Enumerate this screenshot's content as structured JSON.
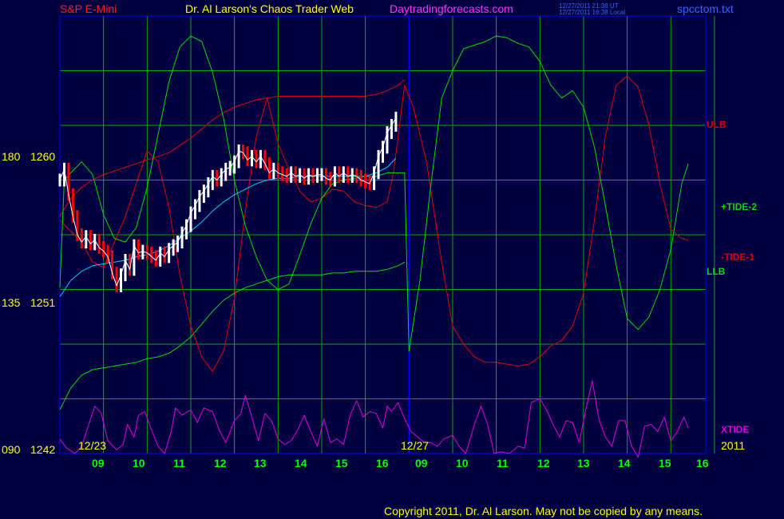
{
  "header": {
    "symbol": "S&P E-Mini",
    "title": "Dr. Al Larson's Chaos Trader Web",
    "site": "Daytradingforecasts.com",
    "utc_stamp": "12/27/2011 21:38 UT",
    "local_stamp": "12/27/2011 16:38 Local",
    "file": "spcctom.txt"
  },
  "footer": {
    "copyright": "Copyright 2011, Dr. Al Larson. May not be copied by any means."
  },
  "colors": {
    "background": "#000040",
    "plot_border": "#0000ff",
    "grid": "#00aa00",
    "price_up": "#ffffff",
    "price_down": "#ff0000",
    "ma": "#00ccff",
    "tide_green": "#00dd00",
    "tide_red": "#dd0000",
    "xtide": "#dd00dd",
    "title_red": "#ff2020",
    "title_yellow": "#ffff00",
    "site_magenta": "#ff33ff",
    "label_blue": "#3366ff",
    "tick_green": "#00ff00"
  },
  "chart_data": {
    "type": "line",
    "title": "S&P E-Mini",
    "y_axis_labels": [
      {
        "angle": "180",
        "price": "1260",
        "value": 1260
      },
      {
        "angle": "135",
        "price": "1251",
        "value": 1251
      },
      {
        "angle": "090",
        "price": "1242",
        "value": 1242
      }
    ],
    "ylim": [
      1242,
      1266
    ],
    "x_hours_day1": [
      "09",
      "10",
      "11",
      "12",
      "13",
      "14",
      "15",
      "16"
    ],
    "x_hours_day2": [
      "09",
      "10",
      "11",
      "12",
      "13",
      "14",
      "15",
      "16"
    ],
    "dates": [
      "12/23",
      "12/27",
      "2011"
    ],
    "series_labels": [
      "ULB",
      "+TIDE-2",
      "-TIDE-1",
      "LLB",
      "XTIDE"
    ],
    "price": [
      [
        0.0,
        1257.0
      ],
      [
        0.2,
        1257.6
      ],
      [
        0.4,
        1256.2
      ],
      [
        0.6,
        1255.0
      ],
      [
        0.8,
        1254.0
      ],
      [
        1.0,
        1253.6
      ],
      [
        1.2,
        1253.9
      ],
      [
        1.4,
        1253.5
      ],
      [
        1.6,
        1253.7
      ],
      [
        1.8,
        1253.3
      ],
      [
        2.0,
        1253.1
      ],
      [
        2.2,
        1252.8
      ],
      [
        2.4,
        1251.9
      ],
      [
        2.6,
        1251.2
      ],
      [
        2.8,
        1251.8
      ],
      [
        3.0,
        1252.6
      ],
      [
        3.2,
        1252.1
      ],
      [
        3.4,
        1253.4
      ],
      [
        3.6,
        1253.0
      ],
      [
        3.8,
        1253.1
      ],
      [
        4.0,
        1253.0
      ],
      [
        4.2,
        1252.8
      ],
      [
        4.4,
        1252.6
      ],
      [
        4.6,
        1253.0
      ],
      [
        4.8,
        1252.8
      ],
      [
        5.0,
        1253.2
      ],
      [
        5.2,
        1253.4
      ],
      [
        5.4,
        1253.6
      ],
      [
        5.6,
        1254.1
      ],
      [
        5.8,
        1254.5
      ],
      [
        6.0,
        1255.2
      ],
      [
        6.2,
        1255.6
      ],
      [
        6.4,
        1256.1
      ],
      [
        6.6,
        1256.4
      ],
      [
        6.8,
        1256.8
      ],
      [
        7.0,
        1257.2
      ],
      [
        7.2,
        1257.0
      ],
      [
        7.4,
        1257.3
      ],
      [
        7.6,
        1257.6
      ],
      [
        7.8,
        1257.7
      ],
      [
        8.0,
        1258.0
      ],
      [
        8.2,
        1258.6
      ],
      [
        8.4,
        1258.5
      ],
      [
        8.6,
        1258.1
      ],
      [
        8.8,
        1258.3
      ],
      [
        9.0,
        1258.0
      ],
      [
        9.2,
        1258.3
      ],
      [
        9.4,
        1257.9
      ],
      [
        9.6,
        1257.4
      ],
      [
        9.8,
        1257.6
      ],
      [
        10.0,
        1257.4
      ],
      [
        10.2,
        1257.3
      ],
      [
        10.4,
        1257.2
      ],
      [
        10.6,
        1257.4
      ],
      [
        10.8,
        1257.2
      ],
      [
        11.0,
        1257.3
      ],
      [
        11.2,
        1257.1
      ],
      [
        11.4,
        1257.3
      ],
      [
        11.6,
        1257.2
      ],
      [
        11.8,
        1257.3
      ],
      [
        12.0,
        1257.3
      ],
      [
        12.2,
        1257.1
      ],
      [
        12.4,
        1257.0
      ],
      [
        12.6,
        1257.4
      ],
      [
        12.8,
        1257.2
      ],
      [
        13.0,
        1257.4
      ],
      [
        13.2,
        1257.2
      ],
      [
        13.4,
        1257.3
      ],
      [
        13.6,
        1257.2
      ],
      [
        13.8,
        1257.0
      ],
      [
        14.0,
        1256.9
      ],
      [
        14.2,
        1256.8
      ],
      [
        14.4,
        1257.4
      ],
      [
        14.6,
        1258.3
      ],
      [
        14.8,
        1258.8
      ],
      [
        15.0,
        1259.6
      ],
      [
        15.2,
        1260.0
      ],
      [
        15.4,
        1260.4
      ]
    ],
    "ma": [
      [
        0.0,
        1250.6
      ],
      [
        0.5,
        1251.5
      ],
      [
        1.0,
        1252.0
      ],
      [
        1.5,
        1252.3
      ],
      [
        2.0,
        1252.4
      ],
      [
        2.5,
        1252.5
      ],
      [
        3.0,
        1252.6
      ],
      [
        3.5,
        1252.8
      ],
      [
        4.0,
        1252.9
      ],
      [
        4.5,
        1253.1
      ],
      [
        5.0,
        1253.4
      ],
      [
        5.5,
        1253.8
      ],
      [
        6.0,
        1254.2
      ],
      [
        6.5,
        1254.7
      ],
      [
        7.0,
        1255.3
      ],
      [
        7.5,
        1255.8
      ],
      [
        8.0,
        1256.2
      ],
      [
        8.5,
        1256.5
      ],
      [
        9.0,
        1256.8
      ],
      [
        9.5,
        1257.0
      ],
      [
        10.0,
        1257.1
      ],
      [
        10.5,
        1257.1
      ],
      [
        11.0,
        1257.2
      ],
      [
        11.5,
        1257.2
      ],
      [
        12.0,
        1257.2
      ],
      [
        12.5,
        1257.2
      ],
      [
        13.0,
        1257.2
      ],
      [
        13.5,
        1257.2
      ],
      [
        14.0,
        1257.2
      ],
      [
        14.5,
        1257.4
      ],
      [
        15.0,
        1257.7
      ],
      [
        15.4,
        1258.2
      ]
    ],
    "ulb": [
      [
        0.0,
        1255.0
      ],
      [
        0.5,
        1256.0
      ],
      [
        1.0,
        1256.6
      ],
      [
        1.5,
        1257.0
      ],
      [
        2.0,
        1257.3
      ],
      [
        2.5,
        1257.5
      ],
      [
        3.0,
        1257.7
      ],
      [
        3.5,
        1257.9
      ],
      [
        4.0,
        1258.1
      ],
      [
        4.5,
        1258.3
      ],
      [
        5.0,
        1258.5
      ],
      [
        5.5,
        1258.9
      ],
      [
        6.0,
        1259.3
      ],
      [
        6.5,
        1259.8
      ],
      [
        7.0,
        1260.3
      ],
      [
        7.5,
        1260.7
      ],
      [
        8.0,
        1261.0
      ],
      [
        8.5,
        1261.2
      ],
      [
        9.0,
        1261.4
      ],
      [
        9.5,
        1261.5
      ],
      [
        10.0,
        1261.6
      ],
      [
        10.5,
        1261.6
      ],
      [
        11.0,
        1261.6
      ],
      [
        11.5,
        1261.6
      ],
      [
        12.0,
        1261.6
      ],
      [
        12.5,
        1261.6
      ],
      [
        13.0,
        1261.6
      ],
      [
        13.5,
        1261.6
      ],
      [
        14.0,
        1261.6
      ],
      [
        14.5,
        1261.7
      ],
      [
        15.0,
        1261.9
      ],
      [
        15.5,
        1262.2
      ],
      [
        15.8,
        1262.5
      ]
    ],
    "llb": [
      [
        0.0,
        1244.4
      ],
      [
        0.5,
        1245.6
      ],
      [
        1.0,
        1246.3
      ],
      [
        1.5,
        1246.6
      ],
      [
        2.0,
        1246.7
      ],
      [
        2.5,
        1246.8
      ],
      [
        3.0,
        1246.9
      ],
      [
        3.5,
        1247.0
      ],
      [
        4.0,
        1247.2
      ],
      [
        4.5,
        1247.3
      ],
      [
        5.0,
        1247.5
      ],
      [
        5.5,
        1247.9
      ],
      [
        6.0,
        1248.4
      ],
      [
        6.5,
        1249.1
      ],
      [
        7.0,
        1249.8
      ],
      [
        7.5,
        1250.4
      ],
      [
        8.0,
        1250.8
      ],
      [
        8.5,
        1251.1
      ],
      [
        9.0,
        1251.3
      ],
      [
        9.5,
        1251.5
      ],
      [
        10.0,
        1251.7
      ],
      [
        10.5,
        1251.8
      ],
      [
        11.0,
        1251.8
      ],
      [
        11.5,
        1251.8
      ],
      [
        12.0,
        1251.8
      ],
      [
        12.5,
        1251.9
      ],
      [
        13.0,
        1251.9
      ],
      [
        13.5,
        1252.0
      ],
      [
        14.0,
        1252.0
      ],
      [
        14.5,
        1252.0
      ],
      [
        15.0,
        1252.1
      ],
      [
        15.5,
        1252.3
      ],
      [
        15.8,
        1252.5
      ]
    ],
    "tide_green": [
      [
        0.0,
        1251.1
      ],
      [
        0.2,
        1257.0
      ],
      [
        0.5,
        1257.4
      ],
      [
        1.0,
        1258.0
      ],
      [
        1.5,
        1257.3
      ],
      [
        2.0,
        1255.1
      ],
      [
        2.5,
        1253.8
      ],
      [
        3.0,
        1253.6
      ],
      [
        3.5,
        1254.4
      ],
      [
        4.0,
        1256.6
      ],
      [
        4.5,
        1259.5
      ],
      [
        5.0,
        1262.4
      ],
      [
        5.5,
        1264.3
      ],
      [
        6.0,
        1264.9
      ],
      [
        6.5,
        1264.6
      ],
      [
        7.0,
        1262.9
      ],
      [
        7.5,
        1260.4
      ],
      [
        8.0,
        1257.0
      ],
      [
        8.5,
        1254.5
      ],
      [
        9.0,
        1252.8
      ],
      [
        9.5,
        1251.5
      ],
      [
        10.0,
        1251.0
      ],
      [
        10.5,
        1251.3
      ],
      [
        11.0,
        1252.9
      ],
      [
        11.5,
        1254.6
      ],
      [
        12.0,
        1256.0
      ],
      [
        12.5,
        1256.8
      ],
      [
        13.0,
        1257.0
      ],
      [
        13.5,
        1257.1
      ],
      [
        14.0,
        1257.2
      ],
      [
        14.5,
        1257.2
      ],
      [
        15.0,
        1257.4
      ],
      [
        15.8,
        1257.4
      ],
      [
        16.0,
        1247.6
      ],
      [
        16.5,
        1251.5
      ],
      [
        17.0,
        1256.7
      ],
      [
        17.5,
        1261.5
      ],
      [
        18.0,
        1263.0
      ],
      [
        18.5,
        1264.2
      ],
      [
        19.0,
        1264.4
      ],
      [
        19.5,
        1264.6
      ],
      [
        20.0,
        1264.9
      ],
      [
        20.5,
        1264.8
      ],
      [
        21.0,
        1264.5
      ],
      [
        21.5,
        1264.3
      ],
      [
        22.0,
        1263.5
      ],
      [
        22.5,
        1262.2
      ],
      [
        23.0,
        1261.5
      ],
      [
        23.5,
        1261.9
      ],
      [
        24.0,
        1261.0
      ],
      [
        24.5,
        1258.8
      ],
      [
        25.0,
        1255.6
      ],
      [
        25.5,
        1252.3
      ],
      [
        26.0,
        1249.4
      ],
      [
        26.5,
        1248.8
      ],
      [
        27.0,
        1249.5
      ],
      [
        27.5,
        1251.0
      ],
      [
        28.0,
        1253.2
      ],
      [
        28.5,
        1256.8
      ],
      [
        28.8,
        1257.9
      ]
    ],
    "tide_red": [
      [
        0.0,
        1254.8
      ],
      [
        0.5,
        1254.2
      ],
      [
        1.0,
        1253.6
      ],
      [
        1.5,
        1252.5
      ],
      [
        2.0,
        1252.2
      ],
      [
        2.5,
        1253.6
      ],
      [
        3.0,
        1255.0
      ],
      [
        3.5,
        1256.8
      ],
      [
        4.0,
        1258.6
      ],
      [
        4.5,
        1258.0
      ],
      [
        5.0,
        1255.5
      ],
      [
        5.5,
        1251.8
      ],
      [
        6.0,
        1249.0
      ],
      [
        6.5,
        1247.3
      ],
      [
        7.0,
        1246.5
      ],
      [
        7.5,
        1247.6
      ],
      [
        8.0,
        1250.5
      ],
      [
        8.5,
        1255.3
      ],
      [
        9.0,
        1259.4
      ],
      [
        9.5,
        1261.5
      ],
      [
        10.0,
        1259.0
      ],
      [
        10.5,
        1257.6
      ],
      [
        11.0,
        1256.4
      ],
      [
        11.5,
        1255.8
      ],
      [
        12.0,
        1256.0
      ],
      [
        12.5,
        1256.5
      ],
      [
        13.0,
        1256.4
      ],
      [
        13.5,
        1255.8
      ],
      [
        14.0,
        1255.6
      ],
      [
        14.5,
        1255.5
      ],
      [
        15.0,
        1255.8
      ],
      [
        15.3,
        1257.5
      ],
      [
        15.8,
        1262.2
      ],
      [
        16.2,
        1261.0
      ],
      [
        16.8,
        1258.0
      ],
      [
        17.5,
        1252.5
      ],
      [
        18.0,
        1249.0
      ],
      [
        18.5,
        1248.0
      ],
      [
        19.0,
        1247.3
      ],
      [
        19.5,
        1247.0
      ],
      [
        20.0,
        1247.0
      ],
      [
        20.5,
        1246.9
      ],
      [
        21.0,
        1246.8
      ],
      [
        21.5,
        1246.9
      ],
      [
        22.0,
        1247.3
      ],
      [
        22.5,
        1247.9
      ],
      [
        23.0,
        1248.2
      ],
      [
        23.5,
        1249.0
      ],
      [
        24.0,
        1250.8
      ],
      [
        24.5,
        1254.8
      ],
      [
        25.0,
        1259.4
      ],
      [
        25.5,
        1262.2
      ],
      [
        26.0,
        1262.7
      ],
      [
        26.5,
        1262.1
      ],
      [
        27.0,
        1260.0
      ],
      [
        27.5,
        1256.8
      ],
      [
        28.0,
        1254.3
      ],
      [
        28.5,
        1253.8
      ],
      [
        28.8,
        1253.7
      ]
    ],
    "xtide": [
      [
        0.0,
        1242.8
      ],
      [
        0.3,
        1242.3
      ],
      [
        0.7,
        1242.0
      ],
      [
        1.0,
        1242.4
      ],
      [
        1.3,
        1243.5
      ],
      [
        1.6,
        1244.6
      ],
      [
        1.9,
        1244.2
      ],
      [
        2.2,
        1242.7
      ],
      [
        2.6,
        1242.2
      ],
      [
        2.9,
        1242.5
      ],
      [
        3.1,
        1243.6
      ],
      [
        3.4,
        1242.9
      ],
      [
        3.6,
        1244.1
      ],
      [
        3.9,
        1244.3
      ],
      [
        4.1,
        1243.6
      ],
      [
        4.5,
        1242.4
      ],
      [
        4.8,
        1242.0
      ],
      [
        5.1,
        1243.2
      ],
      [
        5.3,
        1244.5
      ],
      [
        5.6,
        1244.1
      ],
      [
        6.0,
        1244.4
      ],
      [
        6.3,
        1243.7
      ],
      [
        6.6,
        1244.5
      ],
      [
        7.0,
        1244.3
      ],
      [
        7.3,
        1243.3
      ],
      [
        7.6,
        1242.6
      ],
      [
        8.0,
        1243.8
      ],
      [
        8.3,
        1244.2
      ],
      [
        8.5,
        1245.2
      ],
      [
        8.8,
        1244.0
      ],
      [
        9.1,
        1242.7
      ],
      [
        9.4,
        1244.2
      ],
      [
        9.7,
        1243.8
      ],
      [
        10.0,
        1242.8
      ],
      [
        10.3,
        1242.5
      ],
      [
        10.6,
        1242.7
      ],
      [
        10.9,
        1243.3
      ],
      [
        11.2,
        1244.1
      ],
      [
        11.5,
        1243.2
      ],
      [
        11.8,
        1242.4
      ],
      [
        12.1,
        1243.9
      ],
      [
        12.4,
        1242.6
      ],
      [
        12.7,
        1242.8
      ],
      [
        13.0,
        1242.5
      ],
      [
        13.3,
        1244.1
      ],
      [
        13.6,
        1244.9
      ],
      [
        13.9,
        1244.0
      ],
      [
        14.2,
        1244.3
      ],
      [
        14.5,
        1244.2
      ],
      [
        14.8,
        1243.4
      ],
      [
        15.0,
        1244.6
      ],
      [
        15.2,
        1244.3
      ],
      [
        15.5,
        1244.8
      ],
      [
        15.8,
        1243.9
      ],
      [
        16.1,
        1243.2
      ],
      [
        16.4,
        1242.9
      ],
      [
        16.7,
        1242.6
      ],
      [
        17.0,
        1242.6
      ],
      [
        17.3,
        1242.4
      ],
      [
        17.6,
        1242.8
      ],
      [
        18.0,
        1243.0
      ],
      [
        18.3,
        1242.4
      ],
      [
        18.6,
        1242.0
      ],
      [
        19.0,
        1243.6
      ],
      [
        19.3,
        1244.6
      ],
      [
        19.6,
        1243.6
      ],
      [
        19.9,
        1242.0
      ],
      [
        20.2,
        1242.1
      ],
      [
        20.6,
        1242.0
      ],
      [
        21.0,
        1242.4
      ],
      [
        21.3,
        1242.3
      ],
      [
        21.6,
        1244.8
      ],
      [
        22.0,
        1245.0
      ],
      [
        22.3,
        1244.4
      ],
      [
        22.6,
        1243.6
      ],
      [
        22.9,
        1242.9
      ],
      [
        23.2,
        1243.8
      ],
      [
        23.5,
        1243.7
      ],
      [
        23.8,
        1242.6
      ],
      [
        24.1,
        1244.4
      ],
      [
        24.4,
        1246.0
      ],
      [
        24.7,
        1243.9
      ],
      [
        25.0,
        1242.9
      ],
      [
        25.3,
        1242.4
      ],
      [
        25.6,
        1243.8
      ],
      [
        25.9,
        1243.8
      ],
      [
        26.2,
        1242.4
      ],
      [
        26.5,
        1241.8
      ],
      [
        26.8,
        1243.5
      ],
      [
        27.1,
        1243.6
      ],
      [
        27.4,
        1243.2
      ],
      [
        27.7,
        1244.0
      ],
      [
        28.0,
        1242.7
      ],
      [
        28.3,
        1243.2
      ],
      [
        28.6,
        1244.0
      ],
      [
        28.8,
        1243.4
      ]
    ]
  }
}
